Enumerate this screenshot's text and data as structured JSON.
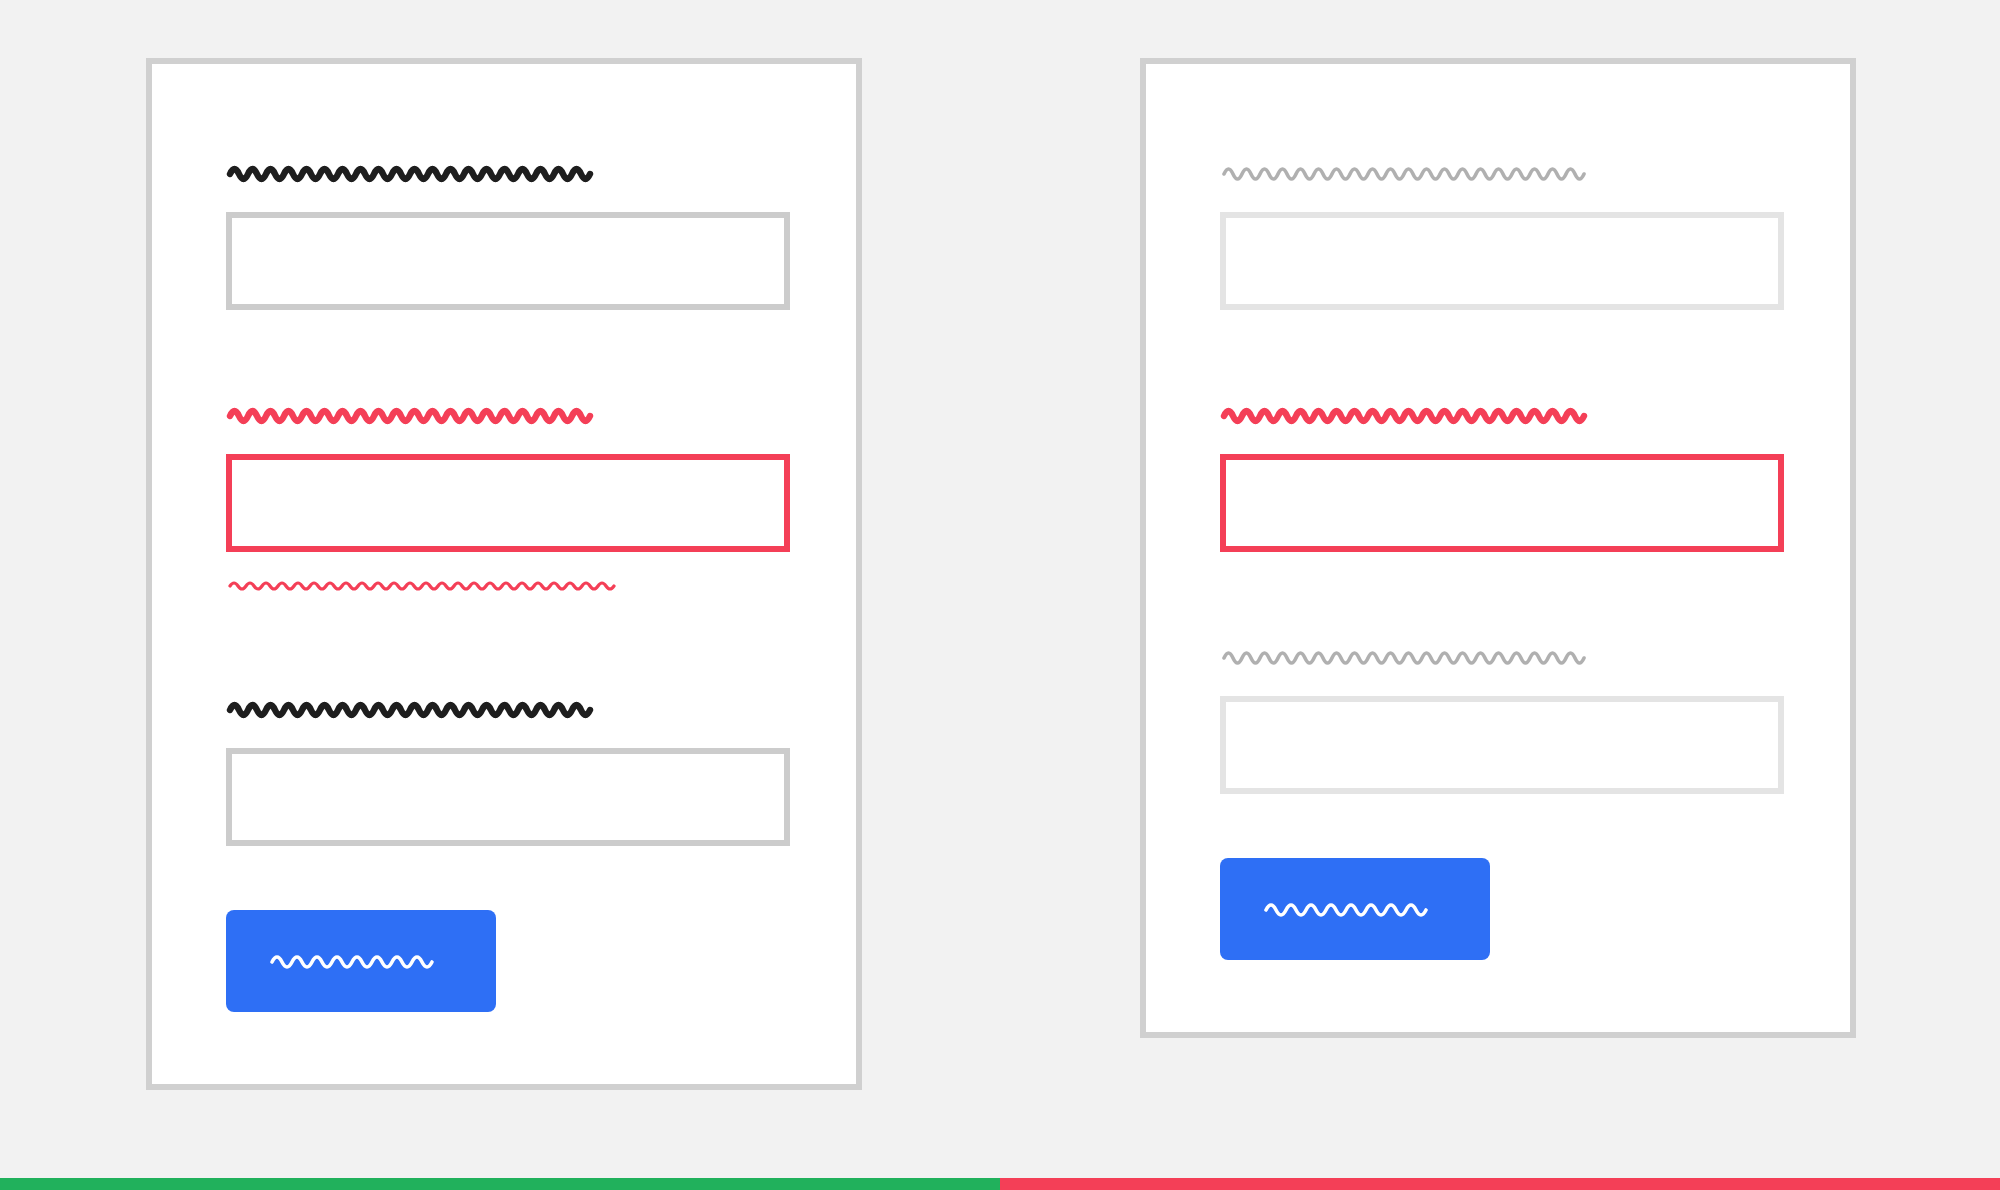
{
  "forms": [
    {
      "fields": [
        {
          "error": false,
          "muted": false,
          "hint": false
        },
        {
          "error": true,
          "muted": false,
          "hint": true
        },
        {
          "error": false,
          "muted": false,
          "hint": false
        }
      ]
    },
    {
      "fields": [
        {
          "error": false,
          "muted": true,
          "hint": false
        },
        {
          "error": true,
          "muted": false,
          "hint": false
        },
        {
          "error": false,
          "muted": true,
          "hint": false
        }
      ]
    }
  ],
  "bottom_bar": [
    {
      "color": "#21b15c"
    },
    {
      "color": "#f43f57"
    }
  ]
}
